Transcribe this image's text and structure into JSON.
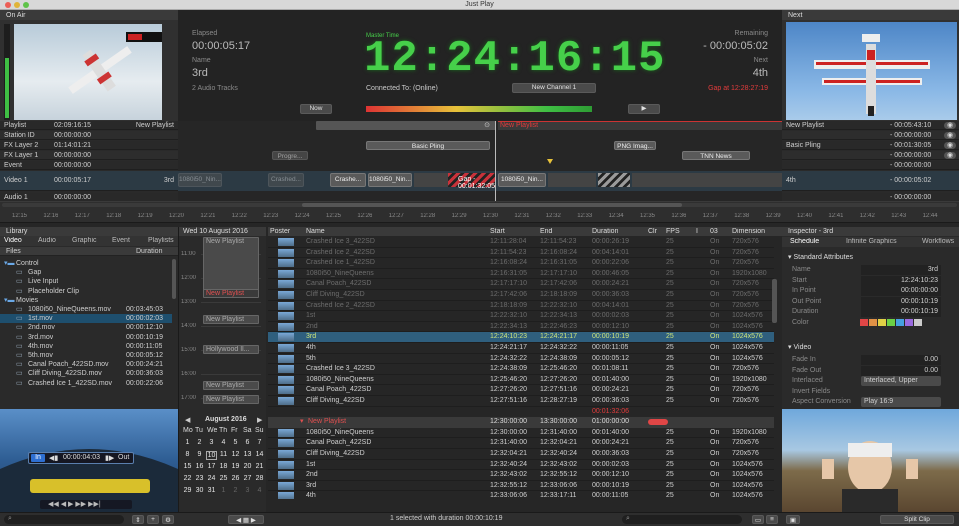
{
  "window": {
    "title": "Just Play"
  },
  "on_air": {
    "label": "On Air"
  },
  "next_panel": {
    "label": "Next"
  },
  "clock": {
    "elapsed_label": "Elapsed",
    "elapsed": "00:00:05:17",
    "name_label": "Name",
    "name": "3rd",
    "audio": "2 Audio Tracks",
    "master_label": "Master Time",
    "master": "12:24:16:15",
    "connected": "Connected To: (Online)",
    "channel": "New Channel 1",
    "remaining_label": "Remaining",
    "remaining": "- 00:00:05:02",
    "next_label": "Next",
    "next": "4th",
    "gap": "Gap at 12:28:27:19",
    "now": "Now"
  },
  "tracks": [
    {
      "name": "Playlist",
      "time": "02:09:16:15",
      "right": "New Playlist"
    },
    {
      "name": "Station ID",
      "time": "00:00:00:00",
      "right": ""
    },
    {
      "name": "FX Layer 2",
      "time": "01:14:01:21",
      "right": ""
    },
    {
      "name": "FX Layer 1",
      "time": "00:00:00:00",
      "right": ""
    },
    {
      "name": "Event",
      "time": "00:00:00:00",
      "right": ""
    },
    {
      "name": "Video 1",
      "time": "00:00:05:17",
      "right": "3rd"
    },
    {
      "name": "Audio 1",
      "time": "00:00:00:00",
      "right": ""
    }
  ],
  "next_tracks": [
    {
      "name": "New Playlist",
      "time": "- 00:05:43:10"
    },
    {
      "name": "",
      "time": "- 00:00:00:00"
    },
    {
      "name": "Basic Pling",
      "time": "- 00:01:30:05"
    },
    {
      "name": "",
      "time": "- 00:00:00:00"
    },
    {
      "name": "",
      "time": "- 00:00:00:00"
    },
    {
      "name": "4th",
      "time": "- 00:00:05:02"
    },
    {
      "name": "",
      "time": "- 00:00:00:00"
    }
  ],
  "timeline": {
    "playlist": "New Playlist",
    "basic_pling": "Basic Pling",
    "png": "PNG Imag...",
    "tnn": "TNN News",
    "progress": "Progre...",
    "crashed": "Crashed...",
    "crashe": "Crashe...",
    "nin": "1080i50_Nin...",
    "nin2": "1080i50_Nin...",
    "nin3": "1080i50_Nin...",
    "gap": "Gap - 00:01:32:05"
  },
  "ruler": [
    "12:15",
    "12:16",
    "12:17",
    "12:18",
    "12:19",
    "12:20",
    "12:21",
    "12:22",
    "12:23",
    "12:24",
    "12:25",
    "12:26",
    "12:27",
    "12:28",
    "12:29",
    "12:30",
    "12:31",
    "12:32",
    "12:33",
    "12:34",
    "12:35",
    "12:36",
    "12:37",
    "12:38",
    "12:39",
    "12:40",
    "12:41",
    "12:42",
    "12:43",
    "12:44"
  ],
  "library": {
    "title": "Library",
    "tabs": [
      "Video",
      "Audio",
      "Graphic",
      "Event",
      "Playlists"
    ],
    "col_files": "Files",
    "col_duration": "Duration",
    "items": [
      {
        "name": "Control",
        "dur": "",
        "indent": 0,
        "folder": true
      },
      {
        "name": "Gap",
        "dur": "",
        "indent": 1
      },
      {
        "name": "Live Input",
        "dur": "",
        "indent": 1
      },
      {
        "name": "Placeholder Clip",
        "dur": "",
        "indent": 1
      },
      {
        "name": "Movies",
        "dur": "",
        "indent": 0,
        "folder": true
      },
      {
        "name": "1080i50_NineQueens.mov",
        "dur": "00:03:45:03",
        "indent": 1
      },
      {
        "name": "1st.mov",
        "dur": "00:00:02:03",
        "indent": 1,
        "selected": true
      },
      {
        "name": "2nd.mov",
        "dur": "00:00:12:10",
        "indent": 1
      },
      {
        "name": "3rd.mov",
        "dur": "00:00:10:19",
        "indent": 1
      },
      {
        "name": "4th.mov",
        "dur": "00:00:11:05",
        "indent": 1
      },
      {
        "name": "5th.mov",
        "dur": "00:00:05:12",
        "indent": 1
      },
      {
        "name": "Canal Poach_422SD.mov",
        "dur": "00:00:24:21",
        "indent": 1
      },
      {
        "name": "Cliff Diving_422SD.mov",
        "dur": "00:00:36:03",
        "indent": 1
      },
      {
        "name": "Crashed Ice 1_422SD.mov",
        "dur": "00:00:22:06",
        "indent": 1
      }
    ]
  },
  "preview": {
    "in": "In",
    "out": "Out",
    "tc": "00:00:04:03"
  },
  "schedule": {
    "date": "Wed 10 August 2016",
    "hours": [
      "11:00",
      "12:00",
      "13:00",
      "14:00",
      "15:00",
      "16:00",
      "17:00"
    ],
    "blocks": [
      "New Playlist",
      "New Playlist",
      "New Playlist",
      "Hollywood Il...",
      "New Playlist",
      "New Playlist"
    ]
  },
  "calendar": {
    "month": "August 2016",
    "days": [
      "Mo",
      "Tu",
      "We",
      "Th",
      "Fr",
      "Sa",
      "Su"
    ],
    "weeks": [
      [
        "1",
        "2",
        "3",
        "4",
        "5",
        "6",
        "7"
      ],
      [
        "8",
        "9",
        "10",
        "11",
        "12",
        "13",
        "14"
      ],
      [
        "15",
        "16",
        "17",
        "18",
        "19",
        "20",
        "21"
      ],
      [
        "22",
        "23",
        "24",
        "25",
        "26",
        "27",
        "28"
      ],
      [
        "29",
        "30",
        "31",
        "1",
        "2",
        "3",
        "4"
      ]
    ],
    "today": "10"
  },
  "playlist": {
    "cols": [
      "Poster",
      "Name",
      "Start",
      "End",
      "Duration",
      "Clr",
      "FPS",
      "I",
      "03",
      "Dimension"
    ],
    "rows": [
      {
        "name": "Crashed Ice 3_422SD",
        "start": "12:11:28:04",
        "end": "12:11:54:23",
        "dur": "00:00:26:19",
        "fps": "25",
        "i": "On",
        "dim": "720x576",
        "past": true
      },
      {
        "name": "Crashed Ice 2_422SD",
        "start": "12:11:54:23",
        "end": "12:16:08:24",
        "dur": "00:04:14:01",
        "fps": "25",
        "i": "On",
        "dim": "720x576",
        "past": true
      },
      {
        "name": "Crashed Ice 1_422SD",
        "start": "12:16:08:24",
        "end": "12:16:31:05",
        "dur": "00:00:22:06",
        "fps": "25",
        "i": "On",
        "dim": "720x576",
        "past": true
      },
      {
        "name": "1080i50_NineQueens",
        "start": "12:16:31:05",
        "end": "12:17:17:10",
        "dur": "00:00:46:05",
        "fps": "25",
        "i": "On",
        "dim": "1920x1080",
        "past": true
      },
      {
        "name": "Canal Poach_422SD",
        "start": "12:17:17:10",
        "end": "12:17:42:06",
        "dur": "00:00:24:21",
        "fps": "25",
        "i": "On",
        "dim": "720x576",
        "past": true
      },
      {
        "name": "Cliff Diving_422SD",
        "start": "12:17:42:06",
        "end": "12:18:18:09",
        "dur": "00:00:36:03",
        "fps": "25",
        "i": "On",
        "dim": "720x576",
        "past": true
      },
      {
        "name": "Crashed Ice 2_422SD",
        "start": "12:18:18:09",
        "end": "12:22:32:10",
        "dur": "00:04:14:01",
        "fps": "25",
        "i": "On",
        "dim": "720x576",
        "past": true
      },
      {
        "name": "1st",
        "start": "12:22:32:10",
        "end": "12:22:34:13",
        "dur": "00:00:02:03",
        "fps": "25",
        "i": "On",
        "dim": "1024x576",
        "past": true
      },
      {
        "name": "2nd",
        "start": "12:22:34:13",
        "end": "12:22:46:23",
        "dur": "00:00:12:10",
        "fps": "25",
        "i": "On",
        "dim": "1024x576",
        "past": true
      },
      {
        "name": "3rd",
        "start": "12:24:10:23",
        "end": "12:24:21:17",
        "dur": "00:00:10:19",
        "fps": "25",
        "i": "On",
        "dim": "1024x576",
        "current": true
      },
      {
        "name": "4th",
        "start": "12:24:21:17",
        "end": "12:24:32:22",
        "dur": "00:00:11:05",
        "fps": "25",
        "i": "On",
        "dim": "1024x576"
      },
      {
        "name": "5th",
        "start": "12:24:32:22",
        "end": "12:24:38:09",
        "dur": "00:00:05:12",
        "fps": "25",
        "i": "On",
        "dim": "1024x576"
      },
      {
        "name": "Crashed Ice 3_422SD",
        "start": "12:24:38:09",
        "end": "12:25:46:20",
        "dur": "00:01:08:11",
        "fps": "25",
        "i": "On",
        "dim": "720x576"
      },
      {
        "name": "1080i50_NineQueens",
        "start": "12:25:46:20",
        "end": "12:27:26:20",
        "dur": "00:01:40:00",
        "fps": "25",
        "i": "On",
        "dim": "1920x1080"
      },
      {
        "name": "Canal Poach_422SD",
        "start": "12:27:26:20",
        "end": "12:27:51:16",
        "dur": "00:00:24:21",
        "fps": "25",
        "i": "On",
        "dim": "720x576"
      },
      {
        "name": "Cliff Diving_422SD",
        "start": "12:27:51:16",
        "end": "12:28:27:19",
        "dur": "00:00:36:03",
        "fps": "25",
        "i": "On",
        "dim": "720x576"
      }
    ],
    "gap_dur": "00:01:32:06",
    "header2": {
      "name": "New Playlist",
      "start": "12:30:00:00",
      "end": "13:30:00:00",
      "dur": "01:00:00:00"
    },
    "rows2": [
      {
        "name": "1080i50_NineQueens",
        "start": "12:30:00:00",
        "end": "12:31:40:00",
        "dur": "00:01:40:00",
        "fps": "25",
        "i": "On",
        "dim": "1920x1080"
      },
      {
        "name": "Canal Poach_422SD",
        "start": "12:31:40:00",
        "end": "12:32:04:21",
        "dur": "00:00:24:21",
        "fps": "25",
        "i": "On",
        "dim": "720x576"
      },
      {
        "name": "Cliff Diving_422SD",
        "start": "12:32:04:21",
        "end": "12:32:40:24",
        "dur": "00:00:36:03",
        "fps": "25",
        "i": "On",
        "dim": "720x576"
      },
      {
        "name": "1st",
        "start": "12:32:40:24",
        "end": "12:32:43:02",
        "dur": "00:00:02:03",
        "fps": "25",
        "i": "On",
        "dim": "1024x576"
      },
      {
        "name": "2nd",
        "start": "12:32:43:02",
        "end": "12:32:55:12",
        "dur": "00:00:12:10",
        "fps": "25",
        "i": "On",
        "dim": "1024x576"
      },
      {
        "name": "3rd",
        "start": "12:32:55:12",
        "end": "12:33:06:06",
        "dur": "00:00:10:19",
        "fps": "25",
        "i": "On",
        "dim": "1024x576"
      },
      {
        "name": "4th",
        "start": "12:33:06:06",
        "end": "12:33:17:11",
        "dur": "00:00:11:05",
        "fps": "25",
        "i": "On",
        "dim": "1024x576"
      },
      {
        "name": "5th",
        "start": "12:33:17:11",
        "end": "12:34:12:11",
        "dur": "00:00:55:00",
        "fps": "25",
        "i": "On",
        "dim": "1024x576"
      }
    ]
  },
  "inspector": {
    "title": "Inspector - 3rd",
    "tabs": [
      "Schedule",
      "Infinite Graphics",
      "Workflows"
    ],
    "section1": "Standard Attributes",
    "fields": [
      {
        "label": "Name",
        "value": "3rd"
      },
      {
        "label": "Start",
        "value": "12:24:10:23"
      },
      {
        "label": "In Point",
        "value": "00:00:00:00"
      },
      {
        "label": "Out Point",
        "value": "00:00:10:19"
      },
      {
        "label": "Duration",
        "value": "00:00:10:19"
      },
      {
        "label": "Color",
        "value": ""
      }
    ],
    "section2": "Video",
    "vfields": [
      {
        "label": "Fade In",
        "value": "0.00"
      },
      {
        "label": "Fade Out",
        "value": "0.00"
      },
      {
        "label": "Interlaced",
        "value": "Interlaced, Upper"
      },
      {
        "label": "Invert Fields",
        "value": ""
      },
      {
        "label": "Aspect Conversion",
        "value": "Play 16:9"
      }
    ],
    "colors": [
      "#e04646",
      "#e09146",
      "#e0d046",
      "#6bd046",
      "#46a0e0",
      "#9a6be0",
      "#cccccc"
    ]
  },
  "status": {
    "text": "1 selected with duration 00:00:10:19",
    "split": "Split Clip"
  }
}
